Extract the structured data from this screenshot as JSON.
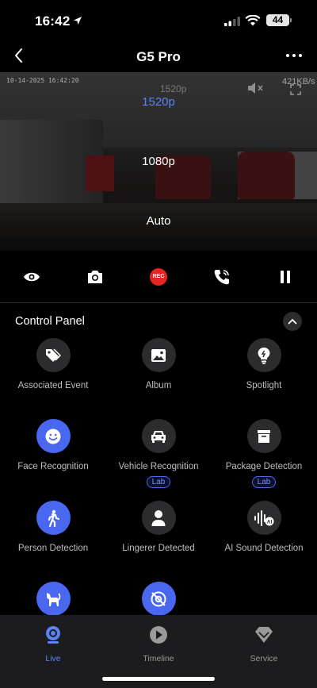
{
  "status_bar": {
    "time": "16:42",
    "battery": "44"
  },
  "nav": {
    "title": "G5 Pro"
  },
  "video": {
    "timestamp": "10-14-2025 16:42:20",
    "current_resolution": "1520p",
    "bitrate": "421KB/s",
    "resolution_options": [
      "1520p",
      "1080p",
      "Auto"
    ],
    "selected_resolution": "1520p"
  },
  "toolbar": {
    "rec_label": "REC"
  },
  "control_panel": {
    "title": "Control Panel",
    "features": [
      {
        "label": "Associated Event",
        "icon": "tag-icon",
        "active": false
      },
      {
        "label": "Album",
        "icon": "image-icon",
        "active": false
      },
      {
        "label": "Spotlight",
        "icon": "bulb-icon",
        "active": false
      },
      {
        "label": "Face Recognition",
        "icon": "face-icon",
        "active": true
      },
      {
        "label": "Vehicle Recognition",
        "icon": "car-icon",
        "active": false,
        "badge": "Lab"
      },
      {
        "label": "Package Detection",
        "icon": "package-icon",
        "active": false,
        "badge": "Lab"
      },
      {
        "label": "Person Detection",
        "icon": "walking-person-icon",
        "active": true
      },
      {
        "label": "Lingerer Detected",
        "icon": "person-icon",
        "active": false
      },
      {
        "label": "AI Sound Detection",
        "icon": "ai-sound-icon",
        "active": false
      },
      {
        "label": "",
        "icon": "cat-icon",
        "active": true
      },
      {
        "label": "",
        "icon": "privacy-off-icon",
        "active": true
      }
    ]
  },
  "tabbar": {
    "tabs": [
      {
        "label": "Live",
        "icon": "camera-icon",
        "active": true
      },
      {
        "label": "Timeline",
        "icon": "play-icon",
        "active": false
      },
      {
        "label": "Service",
        "icon": "diamond-icon",
        "active": false
      }
    ]
  },
  "colors": {
    "accent": "#4a67f0",
    "accent_text": "#5b83f5",
    "rec": "#e52521",
    "background": "#000000"
  }
}
